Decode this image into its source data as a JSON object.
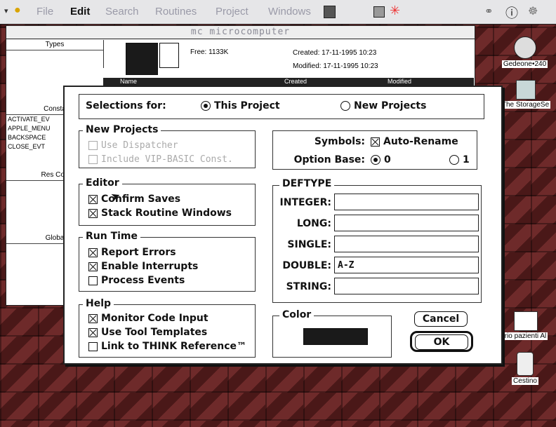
{
  "menubar": {
    "items": [
      "File",
      "Edit",
      "Search",
      "Routines",
      "Project",
      "Windows"
    ]
  },
  "project_window": {
    "title": "mc microcomputer",
    "free": "Free: 1133K",
    "created": "Created: 17-11-1995  10:23",
    "modified": "Modified: 17-11-1995  10:23",
    "col_name": "Name",
    "col_created": "Created",
    "col_modified": "Modified",
    "types_title": "Types",
    "constants_title": "Consta",
    "constants_items": [
      "ACTIVATE_EV",
      "APPLE_MENU",
      "BACKSPACE",
      "CLOSE_EVT"
    ],
    "res_title": "Res Con",
    "globals_title": "Globa"
  },
  "dialog": {
    "selections_label": "Selections for:",
    "this_project": "This Project",
    "new_projects_radio": "New Projects",
    "new_projects_group": {
      "title": "New Projects",
      "use_dispatcher": "Use Dispatcher",
      "include_vip": "Include VIP-BASIC Const."
    },
    "symbols_label": "Symbols:",
    "auto_rename": "Auto-Rename",
    "option_base_label": "Option Base:",
    "option_0": "0",
    "option_1": "1",
    "editor": {
      "title": "Editor",
      "confirm_saves": "Confirm Saves",
      "stack_windows": "Stack Routine Windows"
    },
    "run_time": {
      "title": "Run Time",
      "report_errors": "Report Errors",
      "enable_interrupts": "Enable Interrupts",
      "process_events": "Process Events"
    },
    "help": {
      "title": "Help",
      "monitor_code": "Monitor Code Input",
      "tool_templates": "Use Tool Templates",
      "link_think": "Link to THINK Reference™"
    },
    "deftype": {
      "title": "DEFTYPE",
      "integer_label": "INTEGER:",
      "integer_value": "",
      "long_label": "LONG:",
      "long_value": "",
      "single_label": "SINGLE:",
      "single_value": "",
      "double_label": "DOUBLE:",
      "double_value": "A-Z",
      "string_label": "STRING:",
      "string_value": ""
    },
    "color_title": "Color",
    "color_swatch": "#1a1a1a",
    "cancel": "Cancel",
    "ok": "OK"
  },
  "desktop": {
    "icons": [
      "Gedeone•240",
      "The StorageSe",
      "rio pazienti Al",
      "Cestino"
    ]
  }
}
